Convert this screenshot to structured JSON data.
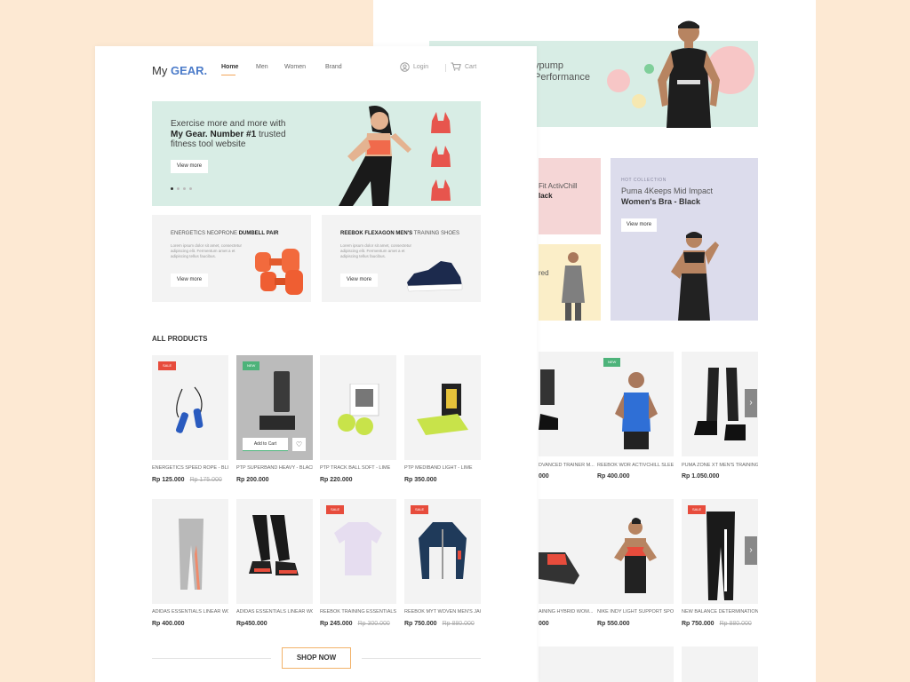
{
  "brand": {
    "prefix": "My",
    "name": "GEAR."
  },
  "nav": {
    "home": "Home",
    "men": "Men",
    "women": "Women",
    "brand": "Brand",
    "login": "Login",
    "cart": "Cart"
  },
  "hero": {
    "line1": "Exercise more and more with",
    "line2": "My Gear. Number #1",
    "line3": "trusted fitness tool website",
    "cta": "View more"
  },
  "promos": [
    {
      "pre": "ENERGETICS NEOPRONE ",
      "bold": "DUMBELL PAIR",
      "post": "",
      "desc": "Lorem ipsum dolor sit amet, consectetur adipiscing elit. Fermentum amet a et adipiscing tellus faucibus.",
      "cta": "View more"
    },
    {
      "pre": "",
      "bold": "REEBOK FLEXAGON MEN'S",
      "post": " TRAINING SHOES",
      "desc": "Lorem ipsum dolor sit amet, consectetur adipiscing elit. Fermentum amet a et adipiscing tellus faucibus.",
      "cta": "View more"
    }
  ],
  "section_title": "ALL PRODUCTS",
  "products": [
    {
      "name": "ENERGETICS SPEED ROPE - BLUE",
      "price": "Rp 125.000",
      "old": "Rp 175.000",
      "badge": "SALE"
    },
    {
      "name": "PTP SUPERBAND HEAVY - BLACK",
      "price": "Rp 200.000",
      "old": "",
      "badge": "NEW"
    },
    {
      "name": "PTP TRACK BALL SOFT - LIME",
      "price": "Rp 220.000",
      "old": "",
      "badge": ""
    },
    {
      "name": "PTP MEDIBAND LIGHT - LIME",
      "price": "Rp 350.000",
      "old": "",
      "badge": ""
    },
    {
      "name": "ADIDAS ESSENTIALS LINEAR WO...",
      "price": "Rp 400.000",
      "old": "",
      "badge": ""
    },
    {
      "name": "ADIDAS ESSENTIALS LINEAR WO...",
      "price": "Rp450.000",
      "old": "",
      "badge": ""
    },
    {
      "name": "REEBOK TRAINING ESSENTIALS E...",
      "price": "Rp 245.000",
      "old": "Rp 300.000",
      "badge": "SALE"
    },
    {
      "name": "REEBOK MYT WOVEN MEN'S JAC...",
      "price": "Rp 750.000",
      "old": "Rp 880.000",
      "badge": "SALE"
    }
  ],
  "add_to_cart": "Add to Cart",
  "shop_now": "SHOP NOW",
  "back": {
    "hero_line1": "ypump",
    "hero_line2": "Performance",
    "col_text1": "Fit ActivChill",
    "col_text2": "lack",
    "col_text3": "red",
    "card_tag": "HOT COLLECTION",
    "card_t1": "Puma 4Keeps Mid Impact",
    "card_t2": "Women's Bra - Black",
    "card_cta": "View more",
    "products": [
      {
        "name": "DVANCED TRAINER M...",
        "price": "000",
        "old": "",
        "badge": ""
      },
      {
        "name": "REEBOK WOR ACTIVCHILL SLEEV...",
        "price": "Rp 400.000",
        "old": "",
        "badge": "NEW"
      },
      {
        "name": "PUMA ZONE XT MEN'S TRAINING...",
        "price": "Rp 1.050.000",
        "old": "",
        "badge": ""
      },
      {
        "name": "AINING HYBRID WOM...",
        "price": "000",
        "old": "",
        "badge": ""
      },
      {
        "name": "NIKE INDY LIGHT SUPPORT SPOR...",
        "price": "Rp 550.000",
        "old": "",
        "badge": ""
      },
      {
        "name": "NEW BALANCE DETERMINATION...",
        "price": "Rp 750.000",
        "old": "Rp 880.000",
        "badge": "SALE"
      }
    ]
  },
  "colors": {
    "background": "#fde9d3",
    "accent_blue": "#4b7bc9",
    "accent_orange": "#f2b269",
    "sale": "#e74c3c",
    "new": "#4db37a",
    "hero_green": "#d8ede5"
  }
}
